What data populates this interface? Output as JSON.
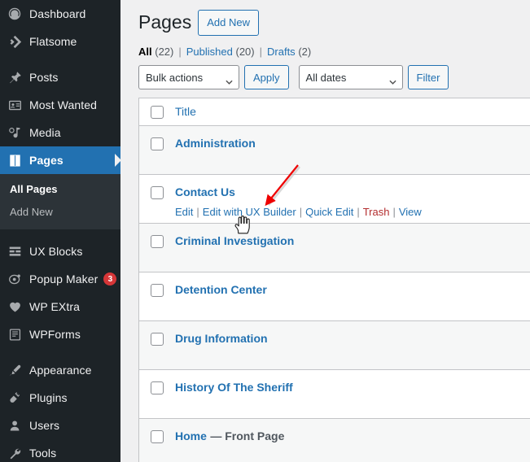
{
  "sidebar": {
    "items": [
      {
        "label": "Dashboard",
        "icon": "dashboard-icon",
        "name": "sidebar-item-dashboard"
      },
      {
        "label": "Flatsome",
        "icon": "flatsome-icon",
        "name": "sidebar-item-flatsome"
      },
      {
        "label": "Posts",
        "icon": "pin-icon",
        "name": "sidebar-item-posts"
      },
      {
        "label": "Most Wanted",
        "icon": "id-card-icon",
        "name": "sidebar-item-most-wanted"
      },
      {
        "label": "Media",
        "icon": "media-icon",
        "name": "sidebar-item-media"
      },
      {
        "label": "Pages",
        "icon": "pages-icon",
        "name": "sidebar-item-pages",
        "current": true
      },
      {
        "label": "UX Blocks",
        "icon": "blocks-icon",
        "name": "sidebar-item-ux-blocks"
      },
      {
        "label": "Popup Maker",
        "icon": "popup-icon",
        "name": "sidebar-item-popup-maker",
        "badge": "3"
      },
      {
        "label": "WP EXtra",
        "icon": "heart-icon",
        "name": "sidebar-item-wp-extra"
      },
      {
        "label": "WPForms",
        "icon": "form-icon",
        "name": "sidebar-item-wpforms"
      },
      {
        "label": "Appearance",
        "icon": "paintbrush-icon",
        "name": "sidebar-item-appearance"
      },
      {
        "label": "Plugins",
        "icon": "plug-icon",
        "name": "sidebar-item-plugins"
      },
      {
        "label": "Users",
        "icon": "user-icon",
        "name": "sidebar-item-users"
      },
      {
        "label": "Tools",
        "icon": "wrench-icon",
        "name": "sidebar-item-tools"
      }
    ],
    "submenu": [
      {
        "label": "All Pages",
        "current": true,
        "name": "submenu-item-all-pages"
      },
      {
        "label": "Add New",
        "current": false,
        "name": "submenu-item-add-new"
      }
    ],
    "badge_color": "#d63638",
    "current_color": "#2271b1"
  },
  "header": {
    "title": "Pages",
    "add_new_label": "Add New"
  },
  "views": [
    {
      "label": "All",
      "count": "(22)",
      "current": true
    },
    {
      "label": "Published",
      "count": "(20)",
      "current": false
    },
    {
      "label": "Drafts",
      "count": "(2)",
      "current": false
    }
  ],
  "view_separator": "|",
  "toolbar": {
    "bulk_actions_value": "Bulk actions",
    "apply_label": "Apply",
    "dates_value": "All dates",
    "filter_label": "Filter"
  },
  "table": {
    "columns": [
      "Title"
    ],
    "rows": [
      {
        "title": "Administration",
        "state": "",
        "actions": []
      },
      {
        "title": "Contact Us",
        "state": "",
        "actions": [
          {
            "label": "Edit",
            "kind": "link"
          },
          {
            "label": "Edit with UX Builder",
            "kind": "link"
          },
          {
            "label": "Quick Edit",
            "kind": "link"
          },
          {
            "label": "Trash",
            "kind": "trash"
          },
          {
            "label": "View",
            "kind": "link"
          }
        ]
      },
      {
        "title": "Criminal Investigation",
        "state": "",
        "actions": []
      },
      {
        "title": "Detention Center",
        "state": "",
        "actions": []
      },
      {
        "title": "Drug Information",
        "state": "",
        "actions": []
      },
      {
        "title": "History Of The Sheriff",
        "state": "",
        "actions": []
      },
      {
        "title": "Home",
        "state": "— Front Page",
        "actions": []
      }
    ],
    "action_separator": "|"
  },
  "annotation": {
    "arrow_color": "#ee0000"
  }
}
